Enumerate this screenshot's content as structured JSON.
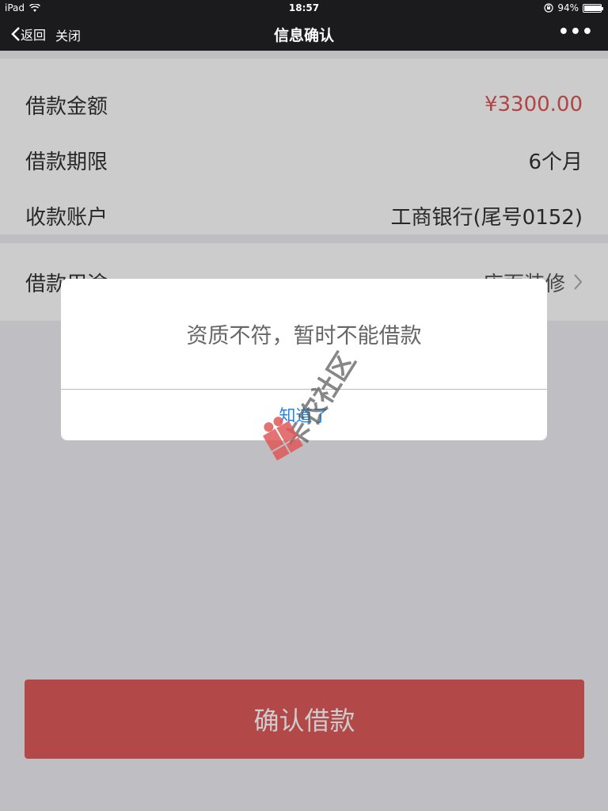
{
  "status": {
    "device": "iPad",
    "time": "18:57",
    "battery": "94%",
    "battery_level": 0.94
  },
  "nav": {
    "back_label": "返回",
    "close_label": "关闭",
    "title": "信息确认",
    "more_label": "•••"
  },
  "form": {
    "rows": [
      {
        "label": "借款金额",
        "value": "¥3300.00"
      },
      {
        "label": "借款期限",
        "value": "6个月"
      },
      {
        "label": "收款账户",
        "value": "工商银行(尾号0152)"
      },
      {
        "label": "借款用途",
        "value": "店面装修"
      }
    ]
  },
  "confirm_button": "确认借款",
  "dialog": {
    "message": "资质不符，暂时不能借款",
    "ok_label": "知道了"
  },
  "watermark_text": "卡农社区",
  "colors": {
    "accent_red": "#e05a5a",
    "link_blue": "#1e86e8",
    "nav_bg": "#1b1b1d"
  }
}
